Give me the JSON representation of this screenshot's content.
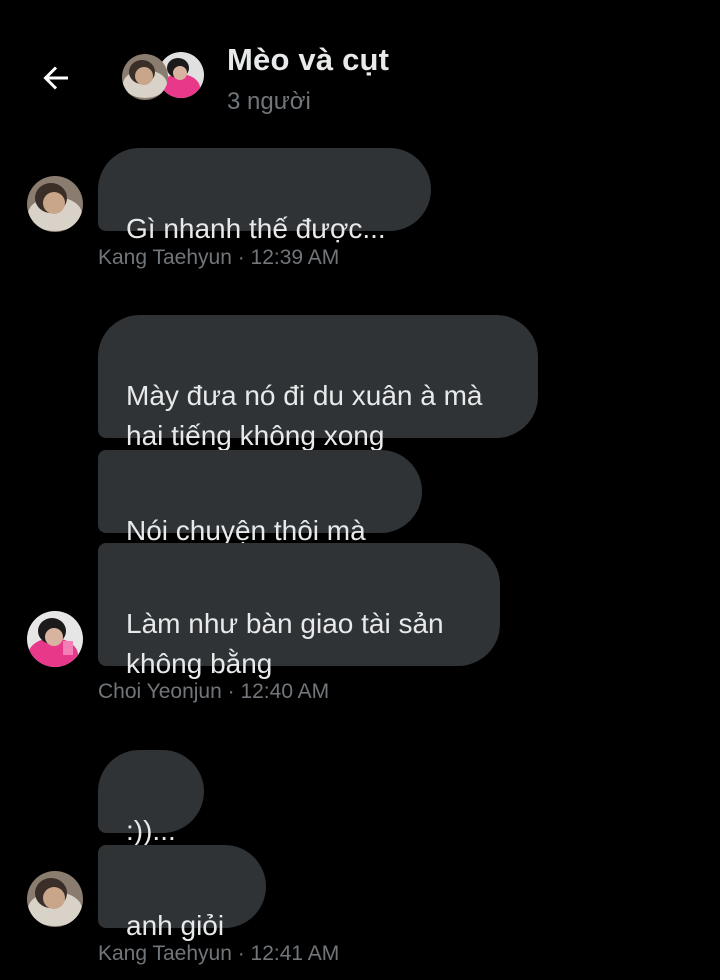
{
  "header": {
    "title": "Mèo và cụt",
    "subtitle": "3 người",
    "back_icon": "arrow-left-icon"
  },
  "messages": [
    {
      "text": "Gì nhanh thế được..."
    },
    {
      "text": "Mày đưa nó đi du xuân à mà\nhai tiếng không xong"
    },
    {
      "text": "Nói chuyện thôi mà"
    },
    {
      "text": "Làm như bàn giao tài sản\nkhông bằng"
    },
    {
      "text": ":))..."
    },
    {
      "text": "anh giỏi"
    }
  ],
  "meta": [
    {
      "sender": "Kang Taehyun",
      "time": "12:39 AM",
      "label": "Kang Taehyun · 12:39 AM"
    },
    {
      "sender": "Choi Yeonjun",
      "time": "12:40 AM",
      "label": "Choi Yeonjun · 12:40 AM"
    },
    {
      "sender": "Kang Taehyun",
      "time": "12:41 AM",
      "label": "Kang Taehyun · 12:41 AM"
    }
  ],
  "colors": {
    "background": "#000000",
    "bubble": "#2f3336",
    "text": "#e7e9ea",
    "muted": "#71767b"
  }
}
